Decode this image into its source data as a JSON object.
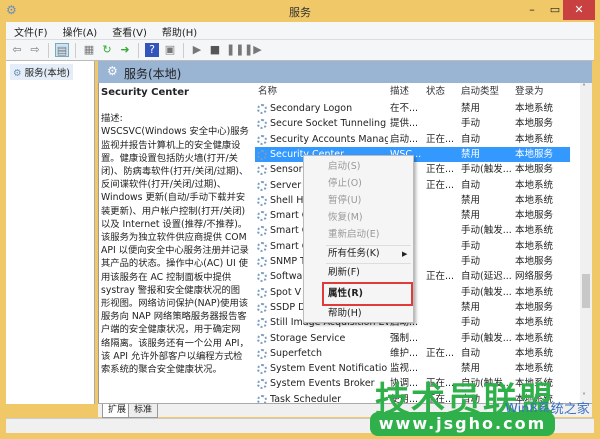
{
  "window": {
    "title": "服务",
    "minimize": "–",
    "maximize": "▭",
    "close": "✕"
  },
  "menu": [
    "文件(F)",
    "操作(A)",
    "查看(V)",
    "帮助(H)"
  ],
  "tree": {
    "root": "服务(本地)"
  },
  "header": {
    "title": "服务(本地)"
  },
  "details": {
    "name": "Security Center",
    "label": "描述:",
    "text": "WSCSVC(Windows 安全中心)服务监视并报告计算机上的安全健康设置。健康设置包括防火墙(打开/关闭)、防病毒软件(打开/关闭/过期)、反间谍软件(打开/关闭/过期)、Windows 更新(自动/手动下载并安装更新)、用户帐户控制(打开/关闭)以及 Internet 设置(推荐/不推荐)。该服务为独立软件供应商提供 COM API 以便向安全中心服务注册并记录其产品的状态。操作中心(AC) UI 使用该服务在 AC 控制面板中提供 systray 警报和安全健康状况的图形视图。网络访问保护(NAP)使用该服务向 NAP 网络策略服务器报告客户端的安全健康状况，用于确定网络隔离。该服务还有一个公用 API，该 API 允许外部客户以编程方式检索系统的聚合安全健康状况。"
  },
  "columns": [
    "名称",
    "描述",
    "状态",
    "启动类型",
    "登录为"
  ],
  "rows": [
    [
      "Secondary Logon",
      "在不...",
      "",
      "禁用",
      "本地系统"
    ],
    [
      "Secure Socket Tunneling ...",
      "提供...",
      "",
      "手动",
      "本地服务"
    ],
    [
      "Security Accounts Manag...",
      "启动...",
      "正在...",
      "自动",
      "本地系统"
    ],
    [
      "Security Center",
      "WSC...",
      "",
      "禁用",
      "本地服务"
    ],
    [
      "Sensor",
      "",
      "正在...",
      "手动(触发...",
      "本地服务"
    ],
    [
      "Server",
      "",
      "正在...",
      "自动",
      "本地系统"
    ],
    [
      "Shell Ha",
      "",
      "",
      "禁用",
      "本地系统"
    ],
    [
      "Smart C",
      "",
      "",
      "禁用",
      "本地服务"
    ],
    [
      "Smart C",
      "",
      "",
      "手动(触发...",
      "本地系统"
    ],
    [
      "Smart C",
      "",
      "",
      "手动",
      "本地系统"
    ],
    [
      "SNMP T",
      "",
      "",
      "手动",
      "本地服务"
    ],
    [
      "Softwar",
      "",
      "正在...",
      "自动(延迟...",
      "网络服务"
    ],
    [
      "Spot V",
      "",
      "",
      "手动(触发...",
      "本地系统"
    ],
    [
      "SSDP D",
      "",
      "",
      "禁用",
      "本地服务"
    ],
    [
      "Still Image Acquisition Eve...",
      "启动...",
      "",
      "手动",
      "本地系统"
    ],
    [
      "Storage Service",
      "强制...",
      "",
      "手动(触发...",
      "本地系统"
    ],
    [
      "Superfetch",
      "维护...",
      "正在...",
      "自动",
      "本地系统"
    ],
    [
      "System Event Notification...",
      "监视...",
      "",
      "禁用",
      "本地系统"
    ],
    [
      "System Events Broker",
      "协调...",
      "正在...",
      "自动(触发...",
      "本地系统"
    ],
    [
      "Task Scheduler",
      "使用...",
      "正在...",
      "自动",
      "本地系统"
    ]
  ],
  "selected_row": 3,
  "context_menu": {
    "start": "启动(S)",
    "stop": "停止(O)",
    "pause": "暂停(U)",
    "resume": "恢复(M)",
    "restart": "重新启动(E)",
    "all_tasks": "所有任务(K)",
    "refresh": "刷新(F)",
    "properties": "属性(R)",
    "help": "帮助(H)"
  },
  "tabs": [
    "扩展",
    "标准"
  ],
  "watermark": {
    "brand": "技术员联盟",
    "url": "www.jsgho.com",
    "sub": "Win8系统之家"
  }
}
